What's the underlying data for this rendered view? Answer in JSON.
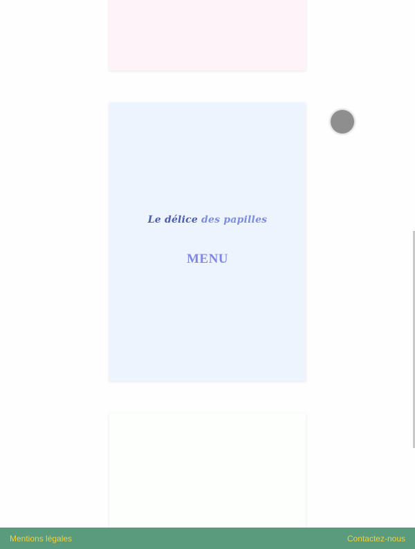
{
  "colors": {
    "card_top_bg": "#fff3fa",
    "card_menu_bg": "#edf4fd",
    "card_bottom_bg": "#fdfffc",
    "brand_dark": "#4a5db0",
    "brand_light": "#7b8ce6",
    "menu_text": "#7f86e8",
    "footer_bg": "#5a9b7d",
    "footer_text": "#f2d13b"
  },
  "brand": {
    "part1": "Le délice",
    "part2": "des papilles"
  },
  "menu_card": {
    "title": "MENU"
  },
  "footer": {
    "legal": "Mentions légales",
    "contact": "Contactez-nous"
  }
}
